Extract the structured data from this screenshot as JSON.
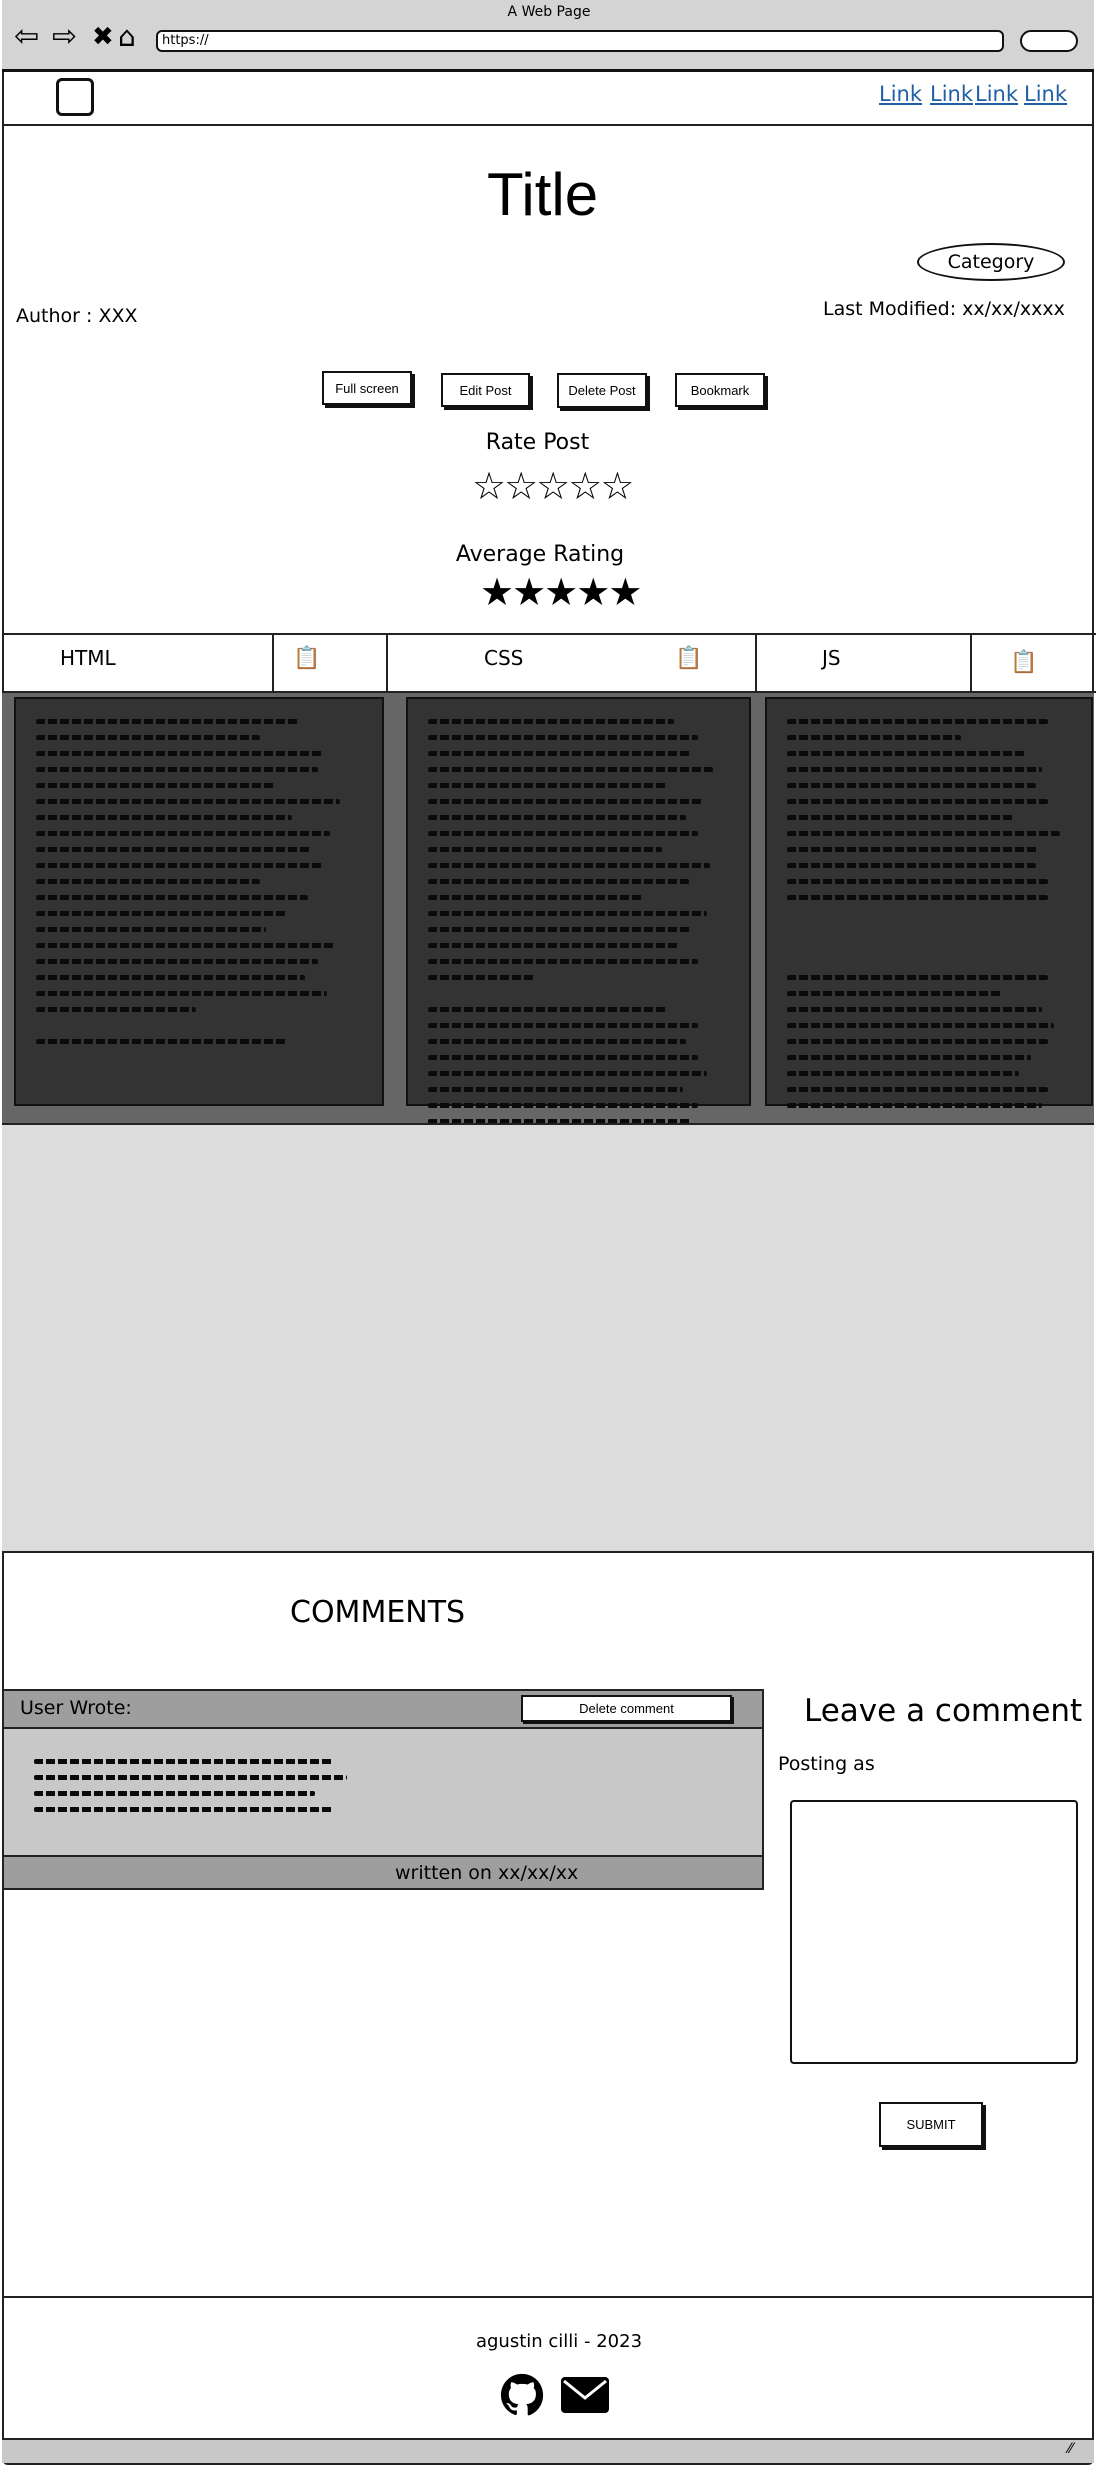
{
  "browser": {
    "window_title": "A Web Page",
    "address": "https://",
    "nav_icons": [
      "arrow-left-icon",
      "arrow-right-icon",
      "close-icon",
      "home-icon"
    ]
  },
  "nav": {
    "links": [
      "Link",
      "Link",
      "Link",
      "Link"
    ]
  },
  "post": {
    "title": "Title",
    "category": "Category",
    "author": "Author : XXX",
    "last_modified": "Last Modified: xx/xx/xxxx",
    "buttons": {
      "full_screen": "Full screen",
      "edit": "Edit Post",
      "delete": "Delete Post",
      "bookmark": "Bookmark"
    },
    "rate_label": "Rate Post",
    "rate_value": 0,
    "average_label": "Average Rating",
    "average_value": 5,
    "rating_max": 5
  },
  "code_tabs": [
    {
      "label": "HTML",
      "icon": "clipboard-icon"
    },
    {
      "label": "CSS",
      "icon": "clipboard-icon"
    },
    {
      "label": "JS",
      "icon": "clipboard-icon"
    }
  ],
  "comments": {
    "heading": "COMMENTS",
    "user_wrote": "User Wrote:",
    "delete_label": "Delete comment",
    "written_on": "written on xx/xx/xx"
  },
  "leave_comment": {
    "heading": "Leave a comment",
    "posting_as": "Posting as",
    "submit_label": "SUBMIT"
  },
  "footer": {
    "credit": "agustin cilli - 2023",
    "icons": [
      "github-icon",
      "mail-icon"
    ]
  }
}
